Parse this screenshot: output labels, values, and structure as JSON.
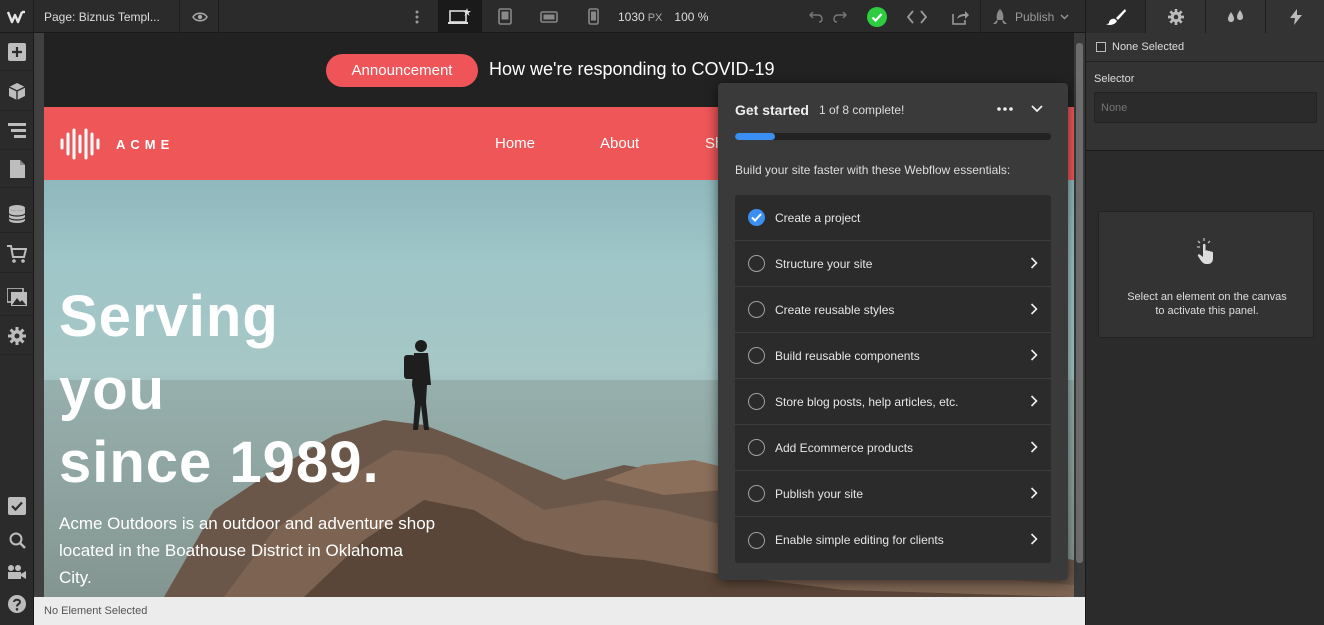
{
  "topbar": {
    "page_label": "Page: Biznus Templ...",
    "width_value": "1030",
    "width_unit": "PX",
    "zoom": "100 %",
    "publish_label": "Publish"
  },
  "canvas": {
    "announcement": {
      "pill": "Announcement",
      "text": "How we're responding to COVID-19"
    },
    "brand": "ACME",
    "nav": [
      "Home",
      "About",
      "Sh"
    ],
    "hero": {
      "title": "Serving\nyou\nsince 1989.",
      "subtitle": "Acme Outdoors is an outdoor and adventure shop located in the Boathouse District in Oklahoma City."
    }
  },
  "statusbar": {
    "text": "No Element Selected"
  },
  "get_started": {
    "title": "Get started",
    "count": "1 of 8 complete!",
    "progress": 0.125,
    "description": "Build your site faster with these Webflow essentials:",
    "items": [
      {
        "label": "Create a project",
        "done": true
      },
      {
        "label": "Structure your site",
        "done": false
      },
      {
        "label": "Create reusable styles",
        "done": false
      },
      {
        "label": "Build reusable components",
        "done": false
      },
      {
        "label": "Store blog posts, help articles, etc.",
        "done": false
      },
      {
        "label": "Add Ecommerce products",
        "done": false
      },
      {
        "label": "Publish your site",
        "done": false
      },
      {
        "label": "Enable simple editing for clients",
        "done": false
      }
    ]
  },
  "rightpanel": {
    "none_selected": "None Selected",
    "selector_label": "Selector",
    "selector_placeholder": "None",
    "empty_message": "Select an element on the canvas\nto activate this panel."
  },
  "colors": {
    "accent_blue": "#3b8ff3",
    "brand_red": "#ee5658",
    "success_green": "#2ecc40"
  }
}
